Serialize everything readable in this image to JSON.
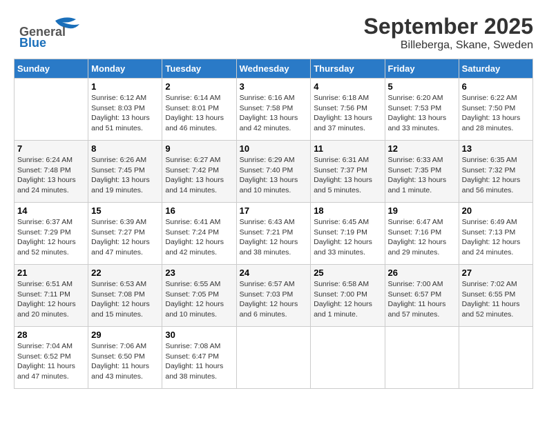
{
  "header": {
    "logo_general": "General",
    "logo_blue": "Blue",
    "title": "September 2025",
    "subtitle": "Billeberga, Skane, Sweden"
  },
  "weekdays": [
    "Sunday",
    "Monday",
    "Tuesday",
    "Wednesday",
    "Thursday",
    "Friday",
    "Saturday"
  ],
  "weeks": [
    [
      {
        "day": "",
        "info": ""
      },
      {
        "day": "1",
        "info": "Sunrise: 6:12 AM\nSunset: 8:03 PM\nDaylight: 13 hours\nand 51 minutes."
      },
      {
        "day": "2",
        "info": "Sunrise: 6:14 AM\nSunset: 8:01 PM\nDaylight: 13 hours\nand 46 minutes."
      },
      {
        "day": "3",
        "info": "Sunrise: 6:16 AM\nSunset: 7:58 PM\nDaylight: 13 hours\nand 42 minutes."
      },
      {
        "day": "4",
        "info": "Sunrise: 6:18 AM\nSunset: 7:56 PM\nDaylight: 13 hours\nand 37 minutes."
      },
      {
        "day": "5",
        "info": "Sunrise: 6:20 AM\nSunset: 7:53 PM\nDaylight: 13 hours\nand 33 minutes."
      },
      {
        "day": "6",
        "info": "Sunrise: 6:22 AM\nSunset: 7:50 PM\nDaylight: 13 hours\nand 28 minutes."
      }
    ],
    [
      {
        "day": "7",
        "info": "Sunrise: 6:24 AM\nSunset: 7:48 PM\nDaylight: 13 hours\nand 24 minutes."
      },
      {
        "day": "8",
        "info": "Sunrise: 6:26 AM\nSunset: 7:45 PM\nDaylight: 13 hours\nand 19 minutes."
      },
      {
        "day": "9",
        "info": "Sunrise: 6:27 AM\nSunset: 7:42 PM\nDaylight: 13 hours\nand 14 minutes."
      },
      {
        "day": "10",
        "info": "Sunrise: 6:29 AM\nSunset: 7:40 PM\nDaylight: 13 hours\nand 10 minutes."
      },
      {
        "day": "11",
        "info": "Sunrise: 6:31 AM\nSunset: 7:37 PM\nDaylight: 13 hours\nand 5 minutes."
      },
      {
        "day": "12",
        "info": "Sunrise: 6:33 AM\nSunset: 7:35 PM\nDaylight: 13 hours\nand 1 minute."
      },
      {
        "day": "13",
        "info": "Sunrise: 6:35 AM\nSunset: 7:32 PM\nDaylight: 12 hours\nand 56 minutes."
      }
    ],
    [
      {
        "day": "14",
        "info": "Sunrise: 6:37 AM\nSunset: 7:29 PM\nDaylight: 12 hours\nand 52 minutes."
      },
      {
        "day": "15",
        "info": "Sunrise: 6:39 AM\nSunset: 7:27 PM\nDaylight: 12 hours\nand 47 minutes."
      },
      {
        "day": "16",
        "info": "Sunrise: 6:41 AM\nSunset: 7:24 PM\nDaylight: 12 hours\nand 42 minutes."
      },
      {
        "day": "17",
        "info": "Sunrise: 6:43 AM\nSunset: 7:21 PM\nDaylight: 12 hours\nand 38 minutes."
      },
      {
        "day": "18",
        "info": "Sunrise: 6:45 AM\nSunset: 7:19 PM\nDaylight: 12 hours\nand 33 minutes."
      },
      {
        "day": "19",
        "info": "Sunrise: 6:47 AM\nSunset: 7:16 PM\nDaylight: 12 hours\nand 29 minutes."
      },
      {
        "day": "20",
        "info": "Sunrise: 6:49 AM\nSunset: 7:13 PM\nDaylight: 12 hours\nand 24 minutes."
      }
    ],
    [
      {
        "day": "21",
        "info": "Sunrise: 6:51 AM\nSunset: 7:11 PM\nDaylight: 12 hours\nand 20 minutes."
      },
      {
        "day": "22",
        "info": "Sunrise: 6:53 AM\nSunset: 7:08 PM\nDaylight: 12 hours\nand 15 minutes."
      },
      {
        "day": "23",
        "info": "Sunrise: 6:55 AM\nSunset: 7:05 PM\nDaylight: 12 hours\nand 10 minutes."
      },
      {
        "day": "24",
        "info": "Sunrise: 6:57 AM\nSunset: 7:03 PM\nDaylight: 12 hours\nand 6 minutes."
      },
      {
        "day": "25",
        "info": "Sunrise: 6:58 AM\nSunset: 7:00 PM\nDaylight: 12 hours\nand 1 minute."
      },
      {
        "day": "26",
        "info": "Sunrise: 7:00 AM\nSunset: 6:57 PM\nDaylight: 11 hours\nand 57 minutes."
      },
      {
        "day": "27",
        "info": "Sunrise: 7:02 AM\nSunset: 6:55 PM\nDaylight: 11 hours\nand 52 minutes."
      }
    ],
    [
      {
        "day": "28",
        "info": "Sunrise: 7:04 AM\nSunset: 6:52 PM\nDaylight: 11 hours\nand 47 minutes."
      },
      {
        "day": "29",
        "info": "Sunrise: 7:06 AM\nSunset: 6:50 PM\nDaylight: 11 hours\nand 43 minutes."
      },
      {
        "day": "30",
        "info": "Sunrise: 7:08 AM\nSunset: 6:47 PM\nDaylight: 11 hours\nand 38 minutes."
      },
      {
        "day": "",
        "info": ""
      },
      {
        "day": "",
        "info": ""
      },
      {
        "day": "",
        "info": ""
      },
      {
        "day": "",
        "info": ""
      }
    ]
  ]
}
